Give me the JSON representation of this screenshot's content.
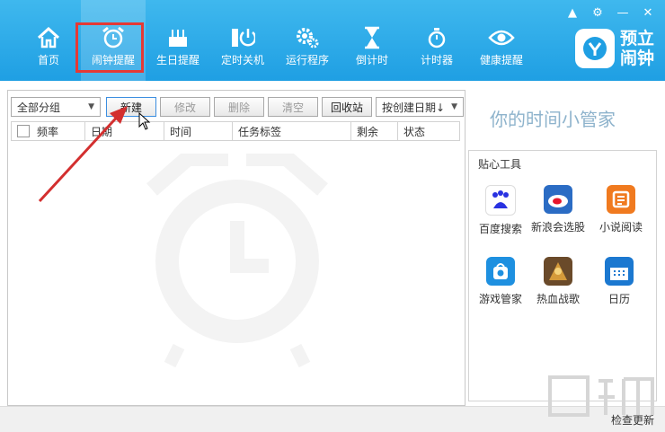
{
  "nav": {
    "items": [
      {
        "label": "首页",
        "icon": "home-icon"
      },
      {
        "label": "闹钟提醒",
        "icon": "alarm-clock-icon"
      },
      {
        "label": "生日提醒",
        "icon": "birthday-cake-icon"
      },
      {
        "label": "定时关机",
        "icon": "power-icon"
      },
      {
        "label": "运行程序",
        "icon": "gears-icon"
      },
      {
        "label": "倒计时",
        "icon": "hourglass-icon"
      },
      {
        "label": "计时器",
        "icon": "stopwatch-icon"
      },
      {
        "label": "健康提醒",
        "icon": "eye-icon"
      }
    ],
    "active_index": 1
  },
  "logo": {
    "line1": "预立",
    "line2": "闹钟"
  },
  "toolbar": {
    "group_select": "全部分组",
    "new_label": "新建",
    "edit_label": "修改",
    "delete_label": "删除",
    "clear_label": "清空",
    "recycle_label": "回收站",
    "sort_select": "按创建日期↓"
  },
  "table": {
    "columns": [
      "频率",
      "日期",
      "时间",
      "任务标签",
      "剩余",
      "状态"
    ]
  },
  "side": {
    "title": "你的时间小管家",
    "tools_title": "贴心工具",
    "tools": [
      {
        "label": "百度搜索",
        "icon": "baidu-icon",
        "color": "#ffffff"
      },
      {
        "label": "新浪会选股",
        "icon": "sina-icon",
        "color": "#2b6cc4"
      },
      {
        "label": "小说阅读",
        "icon": "novel-icon",
        "color": "#f07a1f"
      },
      {
        "label": "游戏管家",
        "icon": "game-bag-icon",
        "color": "#1e90e0"
      },
      {
        "label": "热血战歌",
        "icon": "game-avatar-icon",
        "color": "#6a4a2a"
      },
      {
        "label": "日历",
        "icon": "calendar-icon",
        "color": "#1b78d0"
      }
    ]
  },
  "footer": {
    "check_update": "检查更新"
  },
  "colors": {
    "accent": "#1f9fe3",
    "highlight": "#e53935",
    "arrow": "#d32f2f"
  }
}
